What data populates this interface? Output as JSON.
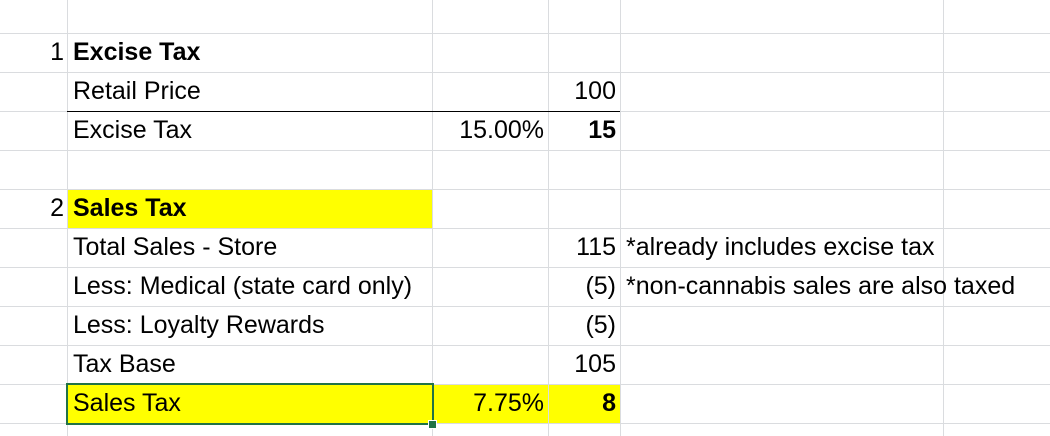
{
  "rows": {
    "r1": {
      "num": "1",
      "title": "Excise Tax"
    },
    "r2": {
      "label": "Retail Price",
      "value": "100"
    },
    "r3": {
      "label": "Excise Tax",
      "rate": "15.00%",
      "value": "15"
    },
    "r5": {
      "num": "2",
      "title": "Sales Tax"
    },
    "r6": {
      "label": "Total Sales - Store",
      "value": "115",
      "note": "*already includes excise tax"
    },
    "r7": {
      "label": "Less: Medical (state card only)",
      "value": "(5)",
      "note": "*non-cannabis sales are also taxed"
    },
    "r8": {
      "label": "Less: Loyalty Rewards",
      "value": "(5)"
    },
    "r9": {
      "label": "Tax Base",
      "value": "105"
    },
    "r10": {
      "label": "Sales Tax",
      "rate": "7.75%",
      "value": "8"
    }
  },
  "colors": {
    "highlight": "#ffff00",
    "selection": "#217346",
    "gridline": "#dadcdf"
  }
}
